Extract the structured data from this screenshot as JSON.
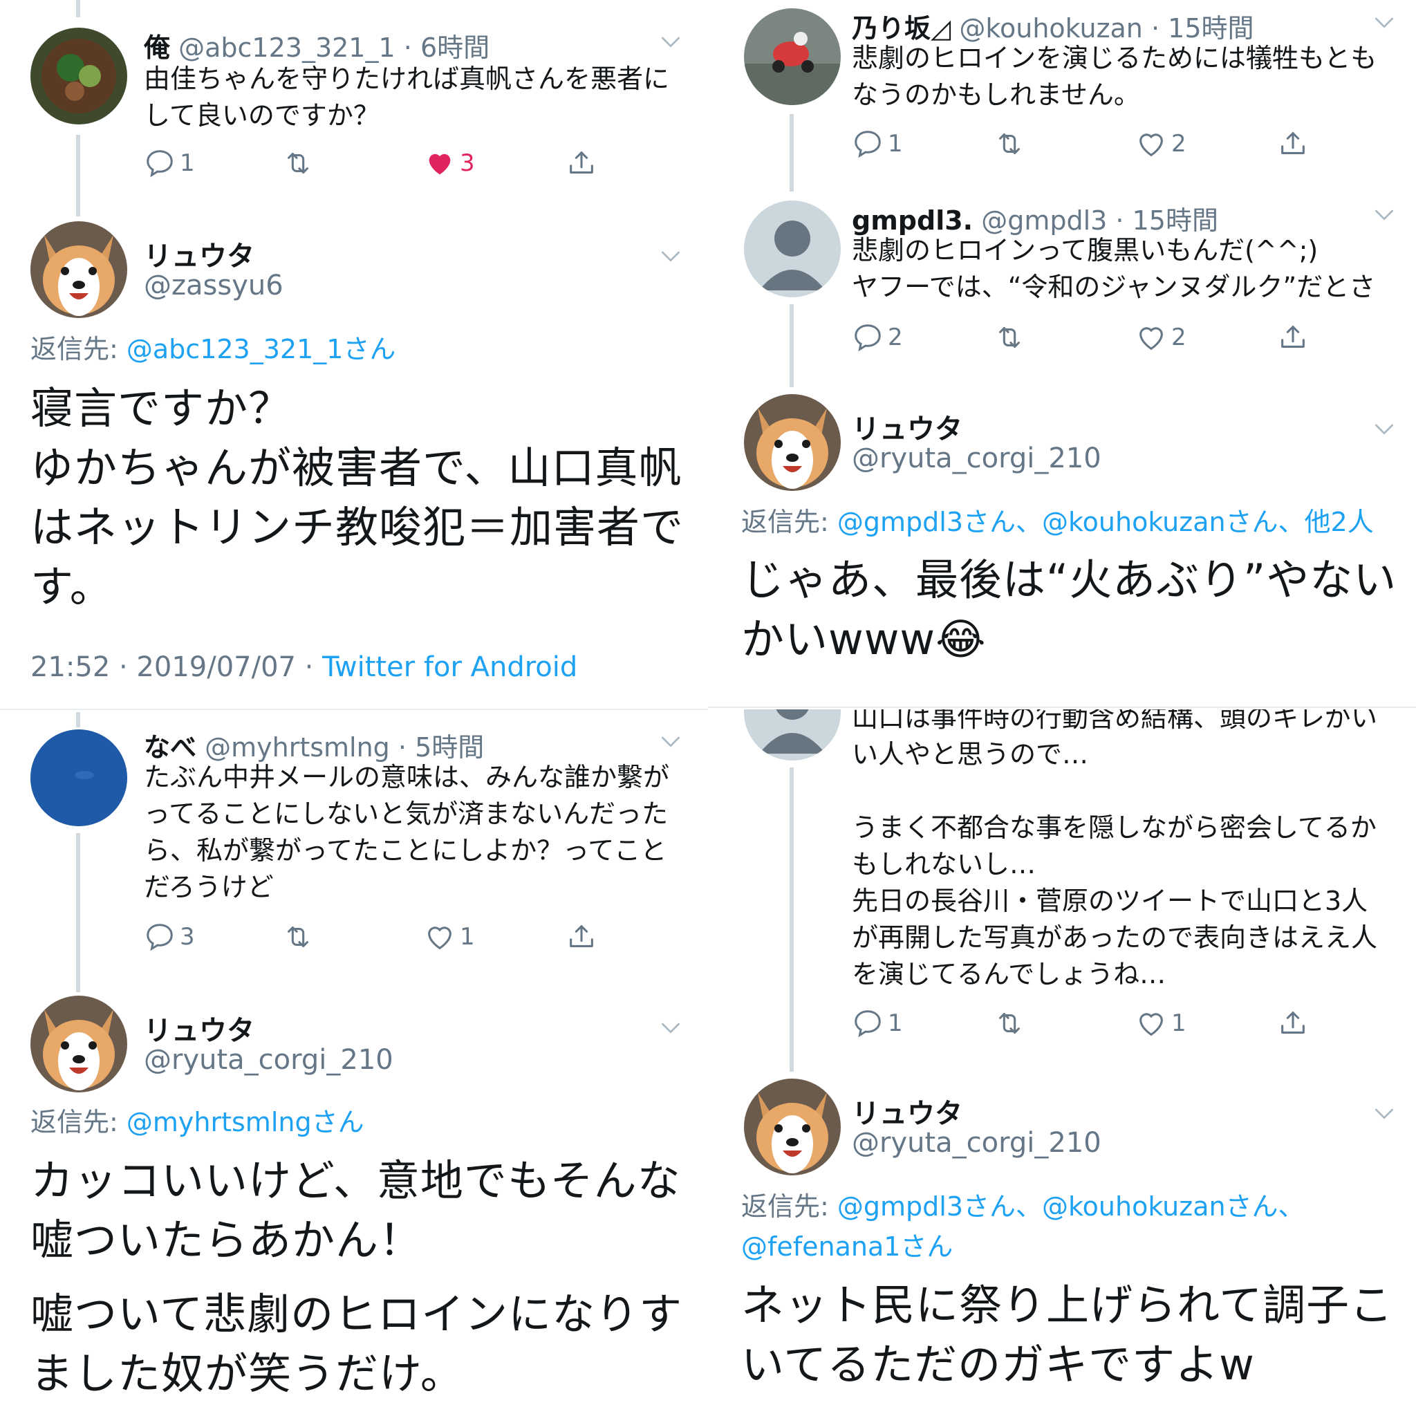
{
  "colors": {
    "link": "#1da1f2",
    "muted": "#657786",
    "like": "#e0245e",
    "line": "#cfd9de"
  },
  "left": {
    "tweet1": {
      "name": "俺",
      "handle": "@abc123_321_1",
      "time": "6時間",
      "lines": [
        "由佳ちゃんを守りたければ真帆さんを悪者に",
        "して良いのですか？"
      ],
      "reply_count": "1",
      "like_count": "3"
    },
    "focus1": {
      "name": "リュウタ",
      "handle": "@zassyu6",
      "reply_label": "返信先: ",
      "reply_target": "@abc123_321_1さん",
      "lines": [
        "寝言ですか？",
        "ゆかちゃんが被害者で、山口真帆",
        "はネットリンチ教唆犯＝加害者で",
        "す。"
      ],
      "time": "21:52 · 2019/07/07 · ",
      "client": "Twitter for Android"
    },
    "tweet2": {
      "name": "なべ",
      "handle": "@myhrtsmlng",
      "time": "5時間",
      "lines": [
        "たぶん中井メールの意味は、みんな誰か繋が",
        "ってることにしないと気が済まないんだった",
        "ら、私が繋がってたことにしよか？ってこと",
        "だろうけど"
      ],
      "reply_count": "3",
      "like_count": "1"
    },
    "focus2": {
      "name": "リュウタ",
      "handle": "@ryuta_corgi_210",
      "reply_label": "返信先: ",
      "reply_target": "@myhrtsmlngさん",
      "lines": [
        "カッコいいけど、意地でもそんな",
        "嘘ついたらあかん！"
      ],
      "lines2": [
        "嘘ついて悲劇のヒロインになりす",
        "ました奴が笑うだけ。"
      ]
    }
  },
  "right": {
    "tweet1": {
      "name": "乃り坂◿",
      "handle": "@kouhokuzan",
      "time": "15時間",
      "lines": [
        "悲劇のヒロインを演じるためには犠牲もとも",
        "なうのかもしれません。"
      ],
      "reply_count": "1",
      "like_count": "2"
    },
    "tweet2": {
      "name": "gmpdl3.",
      "handle": "@gmpdl3",
      "time": "15時間",
      "lines": [
        "悲劇のヒロインって腹黒いもんだ(^^;)",
        "ヤフーでは、“令和のジャンヌダルク”だとさ"
      ],
      "reply_count": "2",
      "like_count": "2"
    },
    "focus1": {
      "name": "リュウタ",
      "handle": "@ryuta_corgi_210",
      "reply_label": "返信先: ",
      "reply_targets": "@gmpdl3さん、@kouhokuzanさん、他2人",
      "lines": [
        "じゃあ、最後は“火あぶり”やない",
        "かいwww😂"
      ]
    },
    "tweet3": {
      "lines": [
        "山口は事件時の行動含め結構、頭のキレがい",
        "い人やと思うので…",
        "",
        "うまく不都合な事を隠しながら密会してるか",
        "もしれないし…",
        "先日の長谷川・菅原のツイートで山口と3人",
        "が再開した写真があったので表向きはええ人",
        "を演じてるんでしょうね…"
      ],
      "reply_count": "1",
      "like_count": "1"
    },
    "focus2": {
      "name": "リュウタ",
      "handle": "@ryuta_corgi_210",
      "reply_label": "返信先: ",
      "reply_targets": "@gmpdl3さん、@kouhokuzanさん、",
      "reply_targets2": "@fefenana1さん",
      "lines": [
        "ネット民に祭り上げられて調子こ",
        "いてるただのガキですよw"
      ]
    }
  },
  "icons": [
    "reply-icon",
    "retweet-icon",
    "like-icon",
    "share-icon",
    "chevron-down-icon"
  ]
}
